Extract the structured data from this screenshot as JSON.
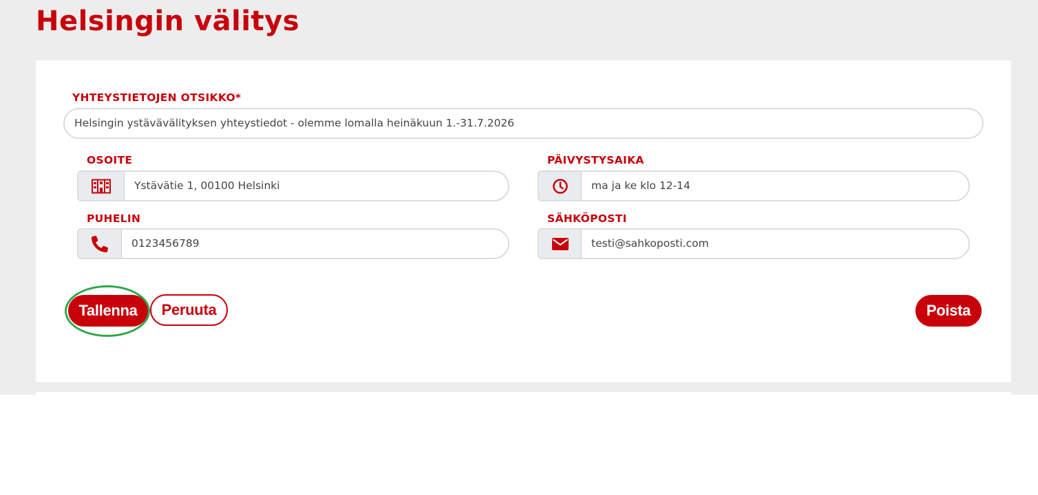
{
  "page": {
    "title": "Helsingin välitys"
  },
  "form": {
    "title_label": "YHTEYSTIETOJEN OTSIKKO*",
    "title_value": "Helsingin ystävävälityksen yhteystiedot - olemme lomalla heinäkuun 1.-31.7.2026",
    "address": {
      "label": "OSOITE",
      "icon": "building-icon",
      "value": "Ystävätie 1, 00100 Helsinki"
    },
    "hours": {
      "label": "PÄIVYSTYSAIKA",
      "icon": "clock-icon",
      "value": "ma ja ke klo 12-14"
    },
    "phone": {
      "label": "PUHELIN",
      "icon": "phone-icon",
      "value": "0123456789"
    },
    "email": {
      "label": "SÄHKÖPOSTI",
      "icon": "envelope-icon",
      "value": "testi@sahkoposti.com"
    }
  },
  "actions": {
    "save_label": "Tallenna",
    "cancel_label": "Peruuta",
    "delete_label": "Poista"
  },
  "colors": {
    "brand_red": "#c8000a",
    "page_background": "#ededed",
    "focus_ring": "#2ea84a"
  }
}
